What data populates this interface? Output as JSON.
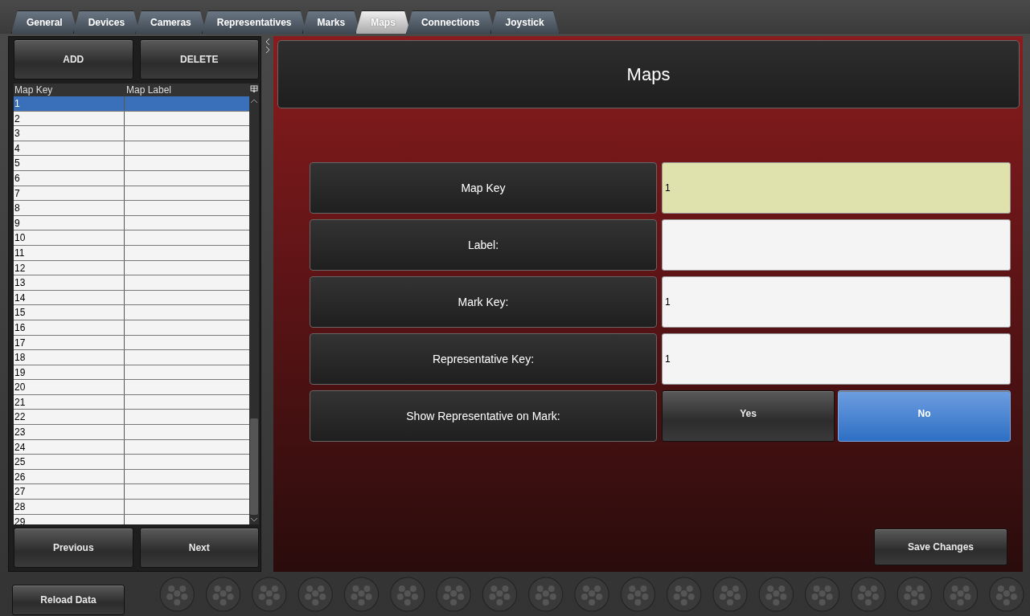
{
  "tabs": [
    {
      "label": "General",
      "selected": false
    },
    {
      "label": "Devices",
      "selected": false
    },
    {
      "label": "Cameras",
      "selected": false
    },
    {
      "label": "Representatives",
      "selected": false
    },
    {
      "label": "Marks",
      "selected": false
    },
    {
      "label": "Maps",
      "selected": true
    },
    {
      "label": "Connections",
      "selected": false
    },
    {
      "label": "Joystick",
      "selected": false
    }
  ],
  "list_panel": {
    "buttons": [
      "ADD",
      "DELETE"
    ],
    "table": {
      "columns": [
        "Map Key",
        "Map Label"
      ],
      "rows": [
        {
          "map_key": "1",
          "selected": true
        },
        {
          "map_key": "2",
          "selected": false
        },
        {
          "map_key": "3",
          "selected": false
        },
        {
          "map_key": "4",
          "selected": false
        },
        {
          "map_key": "5",
          "selected": false
        },
        {
          "map_key": "6",
          "selected": false
        },
        {
          "map_key": "7",
          "selected": false
        },
        {
          "map_key": "8",
          "selected": false
        },
        {
          "map_key": "9",
          "selected": false
        },
        {
          "map_key": "10",
          "selected": false
        },
        {
          "map_key": "11",
          "selected": false
        },
        {
          "map_key": "12",
          "selected": false
        },
        {
          "map_key": "13",
          "selected": false
        },
        {
          "map_key": "14",
          "selected": false
        },
        {
          "map_key": "15",
          "selected": false
        },
        {
          "map_key": "16",
          "selected": false
        },
        {
          "map_key": "17",
          "selected": false
        },
        {
          "map_key": "18",
          "selected": false
        },
        {
          "map_key": "19",
          "selected": false
        },
        {
          "map_key": "20",
          "selected": false
        },
        {
          "map_key": "21",
          "selected": false
        },
        {
          "map_key": "22",
          "selected": false
        },
        {
          "map_key": "23",
          "selected": false
        },
        {
          "map_key": "24",
          "selected": false
        },
        {
          "map_key": "25",
          "selected": false
        },
        {
          "map_key": "26",
          "selected": false
        },
        {
          "map_key": "27",
          "selected": false
        },
        {
          "map_key": "28",
          "selected": false
        },
        {
          "map_key": "29",
          "selected": false
        }
      ]
    },
    "nav_buttons": [
      "Previous",
      "Next"
    ]
  },
  "detail": {
    "title": "Maps",
    "fields": [
      {
        "kind": "text",
        "label": "Map Key",
        "value": "1",
        "focused": true
      },
      {
        "kind": "text",
        "label": "Label:",
        "focused": false
      },
      {
        "kind": "text",
        "label": "Mark Key:",
        "value": "1",
        "focused": false
      },
      {
        "kind": "text",
        "label": "Representative Key:",
        "value": "1",
        "focused": false
      },
      {
        "kind": "toggle",
        "label": "Show Representative on Mark:",
        "options": [
          {
            "label": "Yes",
            "selected": false
          },
          {
            "label": "No",
            "selected": true
          }
        ]
      }
    ],
    "save_button": "Save Changes"
  },
  "footer": {
    "button": "Reload Data"
  }
}
